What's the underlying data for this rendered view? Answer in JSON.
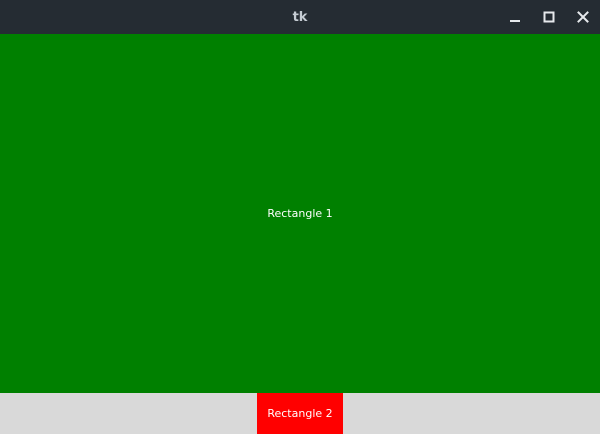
{
  "window": {
    "title": "tk"
  },
  "titlebar": {
    "controls": [
      {
        "name": "minimize",
        "icon": "minimize-icon"
      },
      {
        "name": "maximize",
        "icon": "maximize-icon"
      },
      {
        "name": "close",
        "icon": "close-icon"
      }
    ]
  },
  "colors": {
    "titlebar_bg": "#252c33",
    "window_bg": "#d9d9d9",
    "rect1": "#008000",
    "rect2": "#ff0000",
    "label_text": "#ffffff"
  },
  "canvas": {
    "rect1": {
      "label": "Rectangle 1"
    },
    "rect2": {
      "label": "Rectangle 2"
    }
  }
}
